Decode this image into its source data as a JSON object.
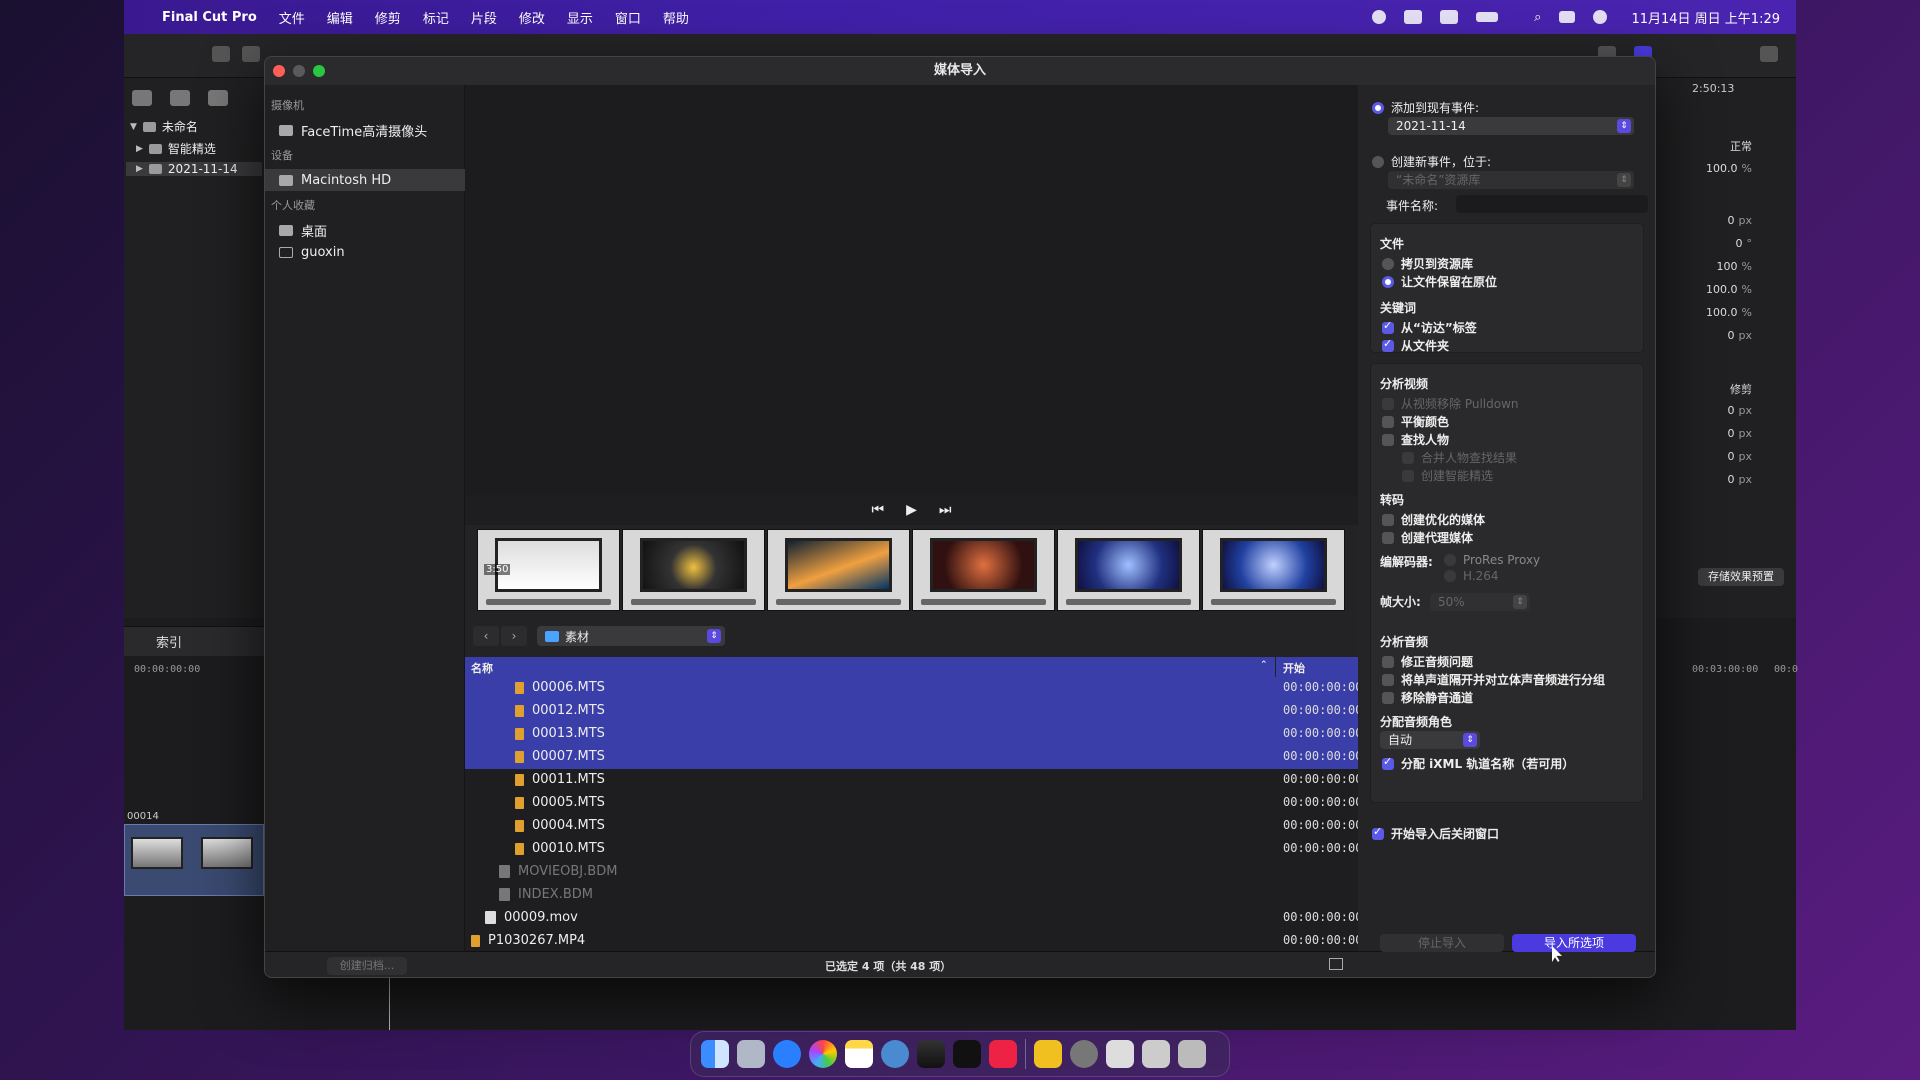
{
  "menubar": {
    "app_name": "Final Cut Pro",
    "items": [
      "文件",
      "编辑",
      "修剪",
      "标记",
      "片段",
      "修改",
      "显示",
      "窗口",
      "帮助"
    ],
    "clock": "11月14日 周日 上午1:29"
  },
  "library": {
    "root": "未命名",
    "smart_collections": "智能精选",
    "event": "2021-11-14",
    "index_label": "索引",
    "timecode": "00:00:00:00",
    "clip_label": "00014"
  },
  "inspector": {
    "timecode": "2:50:13",
    "mode": "正常",
    "rows": [
      {
        "v": "100.0",
        "u": "%"
      },
      {
        "v": "0",
        "u": "px"
      },
      {
        "v": "0",
        "u": "°"
      },
      {
        "v": "100",
        "u": "%"
      },
      {
        "v": "100.0",
        "u": "%"
      },
      {
        "v": "100.0",
        "u": "%"
      },
      {
        "v": "0",
        "u": "px"
      }
    ],
    "crop_label": "修剪",
    "crop_rows": [
      {
        "v": "0",
        "u": "px"
      },
      {
        "v": "0",
        "u": "px"
      },
      {
        "v": "0",
        "u": "px"
      },
      {
        "v": "0",
        "u": "px"
      }
    ],
    "save_preset": "存储效果预置",
    "timecode2": "00:03:00:00",
    "timecode3": "00:0"
  },
  "dialog": {
    "title": "媒体导入",
    "sidebar": {
      "camera_head": "摄像机",
      "camera": "FaceTime高清摄像头",
      "devices_head": "设备",
      "device": "Macintosh HD",
      "favorites_head": "个人收藏",
      "favorites": [
        "桌面",
        "guoxin"
      ],
      "make_archive": "创建归档..."
    },
    "film_duration": "3:50",
    "location": "素材",
    "table": {
      "col_name": "名称",
      "col_start": "开始",
      "rows": [
        {
          "name": "00006.MTS",
          "start": "00:00:00:00",
          "selected": true
        },
        {
          "name": "00012.MTS",
          "start": "00:00:00:00",
          "selected": true
        },
        {
          "name": "00013.MTS",
          "start": "00:00:00:00",
          "selected": true
        },
        {
          "name": "00007.MTS",
          "start": "00:00:00:00",
          "selected": true
        },
        {
          "name": "00011.MTS",
          "start": "00:00:00:00",
          "selected": false
        },
        {
          "name": "00005.MTS",
          "start": "00:00:00:00",
          "selected": false
        },
        {
          "name": "00004.MTS",
          "start": "00:00:00:00",
          "selected": false
        },
        {
          "name": "00010.MTS",
          "start": "00:00:00:00",
          "selected": false
        },
        {
          "name": "MOVIEOBJ.BDM",
          "start": "",
          "selected": false
        },
        {
          "name": "INDEX.BDM",
          "start": "",
          "selected": false
        },
        {
          "name": "00009.mov",
          "start": "00:00:00:00",
          "selected": false
        },
        {
          "name": "P1030267.MP4",
          "start": "00:00:00:00",
          "selected": false
        }
      ]
    },
    "selection_status": "已选定 4 项（共 48 项）",
    "options": {
      "add_existing": "添加到现有事件:",
      "existing_event": "2021-11-14",
      "create_new": "创建新事件，位于:",
      "new_event_library": "“未命名”资源库",
      "event_name_label": "事件名称:",
      "files_head": "文件",
      "copy_to_library": "拷贝到资源库",
      "leave_in_place": "让文件保留在原位",
      "keywords_head": "关键词",
      "from_finder_tags": "从“访达”标签",
      "from_folders": "从文件夹",
      "analyze_video_head": "分析视频",
      "remove_pulldown": "从视频移除 Pulldown",
      "balance_color": "平衡颜色",
      "find_people": "查找人物",
      "consolidate_people": "合并人物查找结果",
      "create_smart_collections": "创建智能精选",
      "transcode_head": "转码",
      "optimized_media": "创建优化的媒体",
      "proxy_media": "创建代理媒体",
      "codec_label": "编解码器:",
      "codec_prores": "ProRes Proxy",
      "codec_h264": "H.264",
      "frame_size_label": "帧大小:",
      "frame_size": "50%",
      "analyze_audio_head": "分析音频",
      "fix_audio": "修正音频问题",
      "separate_mono": "将单声道隔开并对立体声音频进行分组",
      "remove_silent": "移除静音通道",
      "assign_roles_head": "分配音频角色",
      "role": "自动",
      "assign_ixml": "分配 iXML 轨道名称（若可用）",
      "close_after": "开始导入后关闭窗口",
      "stop_import": "停止导入",
      "import_selected": "导入所选项"
    }
  }
}
